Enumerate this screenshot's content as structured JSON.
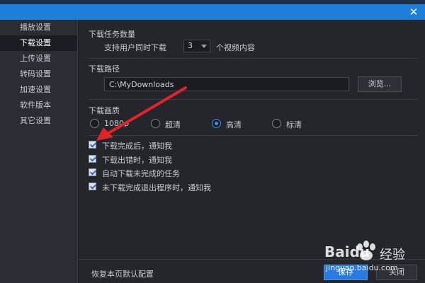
{
  "window": {
    "close_glyph": "✕"
  },
  "sidebar": {
    "items": [
      {
        "label": "播放设置",
        "active": false
      },
      {
        "label": "下载设置",
        "active": true
      },
      {
        "label": "上传设置",
        "active": false
      },
      {
        "label": "转码设置",
        "active": false
      },
      {
        "label": "加速设置",
        "active": false
      },
      {
        "label": "软件版本",
        "active": false
      },
      {
        "label": "其它设置",
        "active": false
      }
    ]
  },
  "task_count": {
    "title": "下载任务数量",
    "prefix": "支持用户同时下载",
    "value": "3",
    "suffix": "个视频内容"
  },
  "download_path": {
    "title": "下载路径",
    "value": "C:\\MyDownloads",
    "browse_label": "浏览..."
  },
  "quality": {
    "title": "下载画质",
    "options": [
      {
        "label": "1080p",
        "checked": false
      },
      {
        "label": "超清",
        "checked": false
      },
      {
        "label": "高清",
        "checked": true
      },
      {
        "label": "标清",
        "checked": false
      }
    ]
  },
  "notifications": {
    "options": [
      {
        "label": "下载完成后，通知我",
        "checked": true
      },
      {
        "label": "下载出错时，通知我",
        "checked": true
      },
      {
        "label": "自动下载未完成的任务",
        "checked": true
      },
      {
        "label": "未下载完成退出程序时，通知我",
        "checked": true
      }
    ]
  },
  "footer": {
    "restore_label": "恢复本页默认配置",
    "save_label": "保存",
    "close_label": "关闭"
  },
  "watermark": {
    "brand": "Baidu",
    "suffix": "经验",
    "url": "jingyan.baidu.com"
  },
  "colors": {
    "titlebar": "#1e7fd8",
    "accent": "#3c8ff0",
    "annotation_arrow": "#e0242a"
  }
}
